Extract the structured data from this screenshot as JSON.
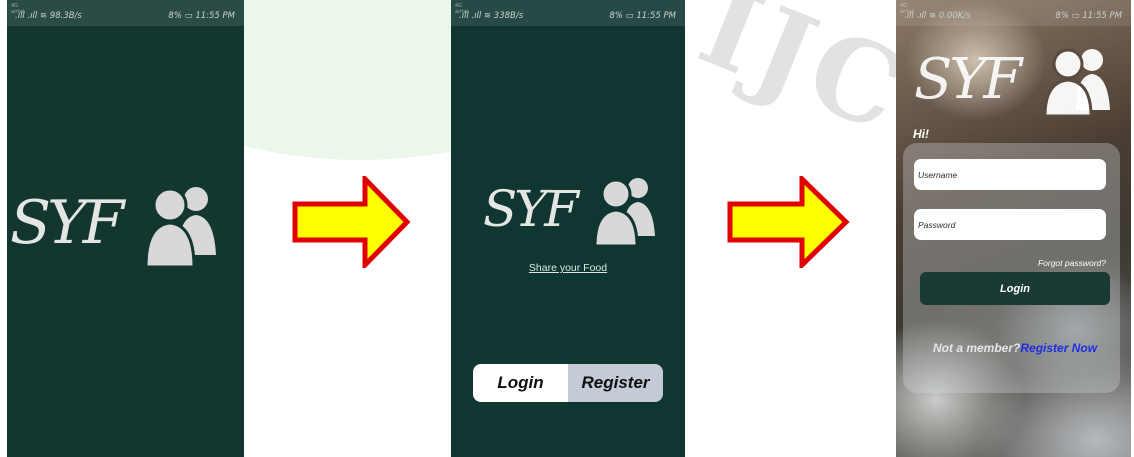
{
  "colors": {
    "splash_bg": "#133730",
    "arrow_fill": "#ffff00",
    "arrow_stroke": "#e00000",
    "register_segment": "#c3cbd6",
    "login_button": "#1b3a33",
    "register_link": "#1e2fe0"
  },
  "watermark": {
    "text": "IJC"
  },
  "screen1": {
    "status": {
      "carrier": "4G\nairtel",
      "network": ".ıll .ıll ≋ 98.3B/s",
      "battery_time": "8% ▭ 11:55 PM"
    },
    "logo": {
      "letters": "SYF",
      "icon": "users-icon"
    }
  },
  "screen2": {
    "status": {
      "carrier": "4G\nairtel",
      "network": ".ıll .ıll ≋ 338B/s",
      "battery_time": "8% ▭ 11:55 PM"
    },
    "logo": {
      "letters": "SYF",
      "icon": "users-icon"
    },
    "tagline": "Share your Food",
    "login_label": "Login",
    "register_label": "Register"
  },
  "screen3": {
    "status": {
      "carrier": "4G\nairtel",
      "network": ".ıll .ıll ≋ 0.00K/s",
      "battery_time": "8% ▭ 11:55 PM"
    },
    "logo": {
      "letters": "SYF",
      "icon": "users-icon"
    },
    "greeting": "Hi!",
    "username_placeholder": "Username",
    "password_placeholder": "Password",
    "forgot_password": "Forgot password?",
    "login_button": "Login",
    "not_member": "Not a member?",
    "register_now": "Register Now"
  }
}
